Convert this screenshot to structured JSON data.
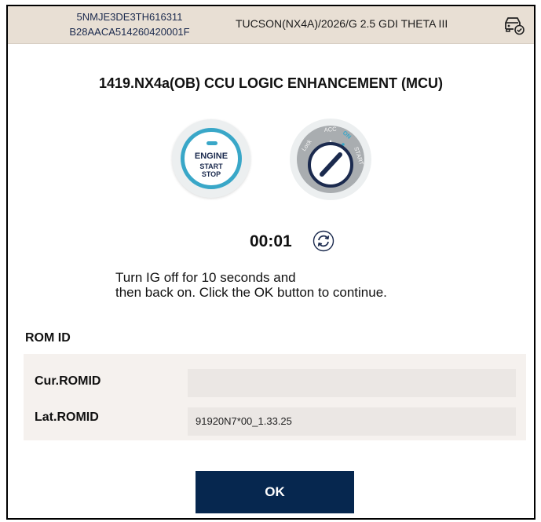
{
  "header": {
    "vin": "5NMJE3DE3TH616311",
    "serial": "B28AACA514260420001F",
    "vehicle": "TUCSON(NX4A)/2026/G 2.5 GDI THETA III",
    "icon": "vehicle-check-icon"
  },
  "procedure": {
    "title": "1419.NX4a(OB) CCU LOGIC ENHANCEMENT (MCU)"
  },
  "engine_button": {
    "line1": "ENGINE",
    "line2": "START",
    "line3": "STOP"
  },
  "ignition_key": {
    "pos_lock": "Lock",
    "pos_acc": "ACC",
    "pos_on": "ON",
    "pos_start": "START"
  },
  "timer": {
    "value": "00:01",
    "icon": "refresh-icon"
  },
  "instruction": {
    "line1": "Turn IG off for 10 seconds and",
    "line2": "then back on. Click the OK button to continue."
  },
  "rom": {
    "section_label": "ROM ID",
    "rows": [
      {
        "label": "Cur.ROMID",
        "value": ""
      },
      {
        "label": "Lat.ROMID",
        "value": "91920N7*00_1.33.25"
      }
    ]
  },
  "actions": {
    "ok_label": "OK"
  },
  "colors": {
    "header_bg": "#e8dfd4",
    "accent_blue": "#39a7c8",
    "button_navy": "#06274f",
    "panel_bg": "#f5f1ee"
  }
}
